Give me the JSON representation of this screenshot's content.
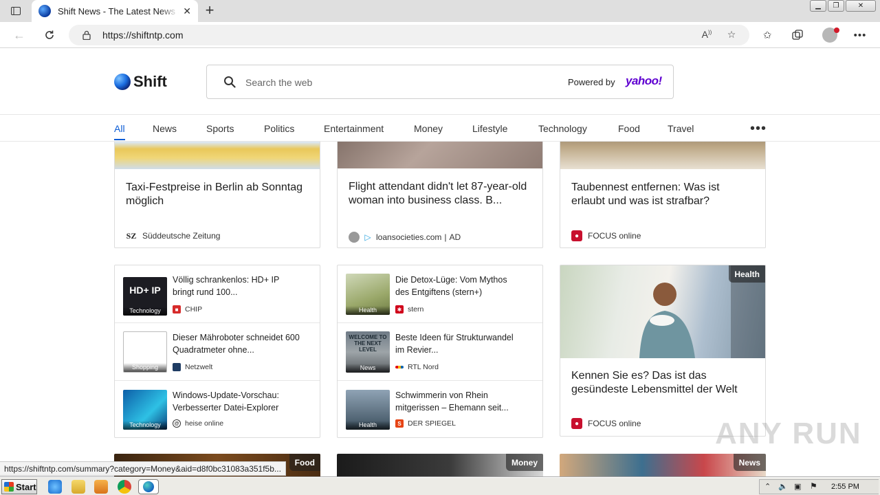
{
  "browser": {
    "tab_title": "Shift News - The Latest News Sports",
    "url": "https://shiftntp.com"
  },
  "header": {
    "brand": "Shift",
    "search_placeholder": "Search the web",
    "powered_by": "Powered by",
    "search_provider": "yahoo!"
  },
  "categories": [
    "All",
    "News",
    "Sports",
    "Politics",
    "Entertainment",
    "Money",
    "Lifestyle",
    "Technology",
    "Food",
    "Travel"
  ],
  "top_cards": [
    {
      "title": "Taxi-Festpreise in Berlin ab Sonntag möglich",
      "source": "Süddeutsche Zeitung",
      "source_logo": "SZ"
    },
    {
      "title": "Flight attendant didn't let 87-year-old woman into business class. B...",
      "source": "loansocieties.com",
      "ad": "AD"
    },
    {
      "title": "Taubennest entfernen: Was ist erlaubt und was ist strafbar?",
      "source": "FOCUS online"
    }
  ],
  "list_left": [
    {
      "title": "Völlig schrankenlos: HD+ IP bringt rund 100...",
      "source": "CHIP",
      "tag": "Technology",
      "thumb_text": "HD+ IP"
    },
    {
      "title": "Dieser Mähroboter schneidet 600 Quadratmeter ohne...",
      "source": "Netzwelt",
      "tag": "Shopping"
    },
    {
      "title": "Windows-Update-Vorschau: Verbesserter Datei-Explorer",
      "source": "heise online",
      "tag": "Technology"
    }
  ],
  "list_mid": [
    {
      "title": "Die Detox-Lüge: Vom Mythos des Entgiftens (stern+)",
      "source": "stern",
      "tag": "Health"
    },
    {
      "title": "Beste Ideen für Strukturwandel im Revier...",
      "source": "RTL Nord",
      "tag": "News",
      "thumb_text": "WELCOME TO THE NEXT LEVEL"
    },
    {
      "title": "Schwimmerin von Rhein mitgerissen – Ehemann seit...",
      "source": "DER SPIEGEL",
      "tag": "Health"
    }
  ],
  "feature_card": {
    "badge": "Health",
    "title": "Kennen Sie es? Das ist das gesündeste Lebensmittel der Welt",
    "source": "FOCUS online"
  },
  "bottom_badges": [
    "Food",
    "Money",
    "News"
  ],
  "status_url": "https://shiftntp.com/summary?category=Money&aid=d8f0bc31083a351f5b...",
  "watermark": "ANY RUN",
  "taskbar": {
    "start": "Start",
    "time": "2:55 PM"
  }
}
